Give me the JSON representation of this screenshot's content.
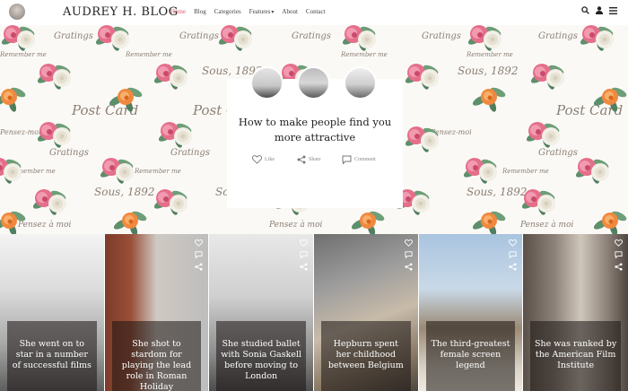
{
  "header": {
    "title": "AUDREY H. BLOG",
    "nav": [
      {
        "label": "Home",
        "active": true
      },
      {
        "label": "Blog",
        "active": false
      },
      {
        "label": "Categories",
        "active": false
      },
      {
        "label": "Features",
        "active": false,
        "dropdown": true
      },
      {
        "label": "About",
        "active": false
      },
      {
        "label": "Contact",
        "active": false
      }
    ],
    "icons": [
      "search-icon",
      "user-icon",
      "menu-icon"
    ]
  },
  "hero": {
    "title": "How to make people find you more attractive",
    "actions": {
      "like": "Like",
      "share": "Share",
      "comment": "Comment"
    },
    "pattern_text": [
      "Gratings",
      "Remember me",
      "Post Card",
      "Sous, 1892",
      "Pensez-moi",
      "Pensez à moi"
    ]
  },
  "tiles": [
    {
      "caption": "She went on to star in a number of successful films"
    },
    {
      "caption": "She shot to stardom for playing the lead role in Roman Holiday"
    },
    {
      "caption": "She studied ballet with Sonia Gaskell before moving to London"
    },
    {
      "caption": "Hepburn spent her childhood between Belgium"
    },
    {
      "caption": "The third-greatest female screen legend"
    },
    {
      "caption": "She was ranked by the American Film Institute"
    }
  ],
  "colors": {
    "accent": "#e0586f",
    "text": "#222222",
    "caption_overlay": "rgba(25,20,18,0.55)"
  }
}
